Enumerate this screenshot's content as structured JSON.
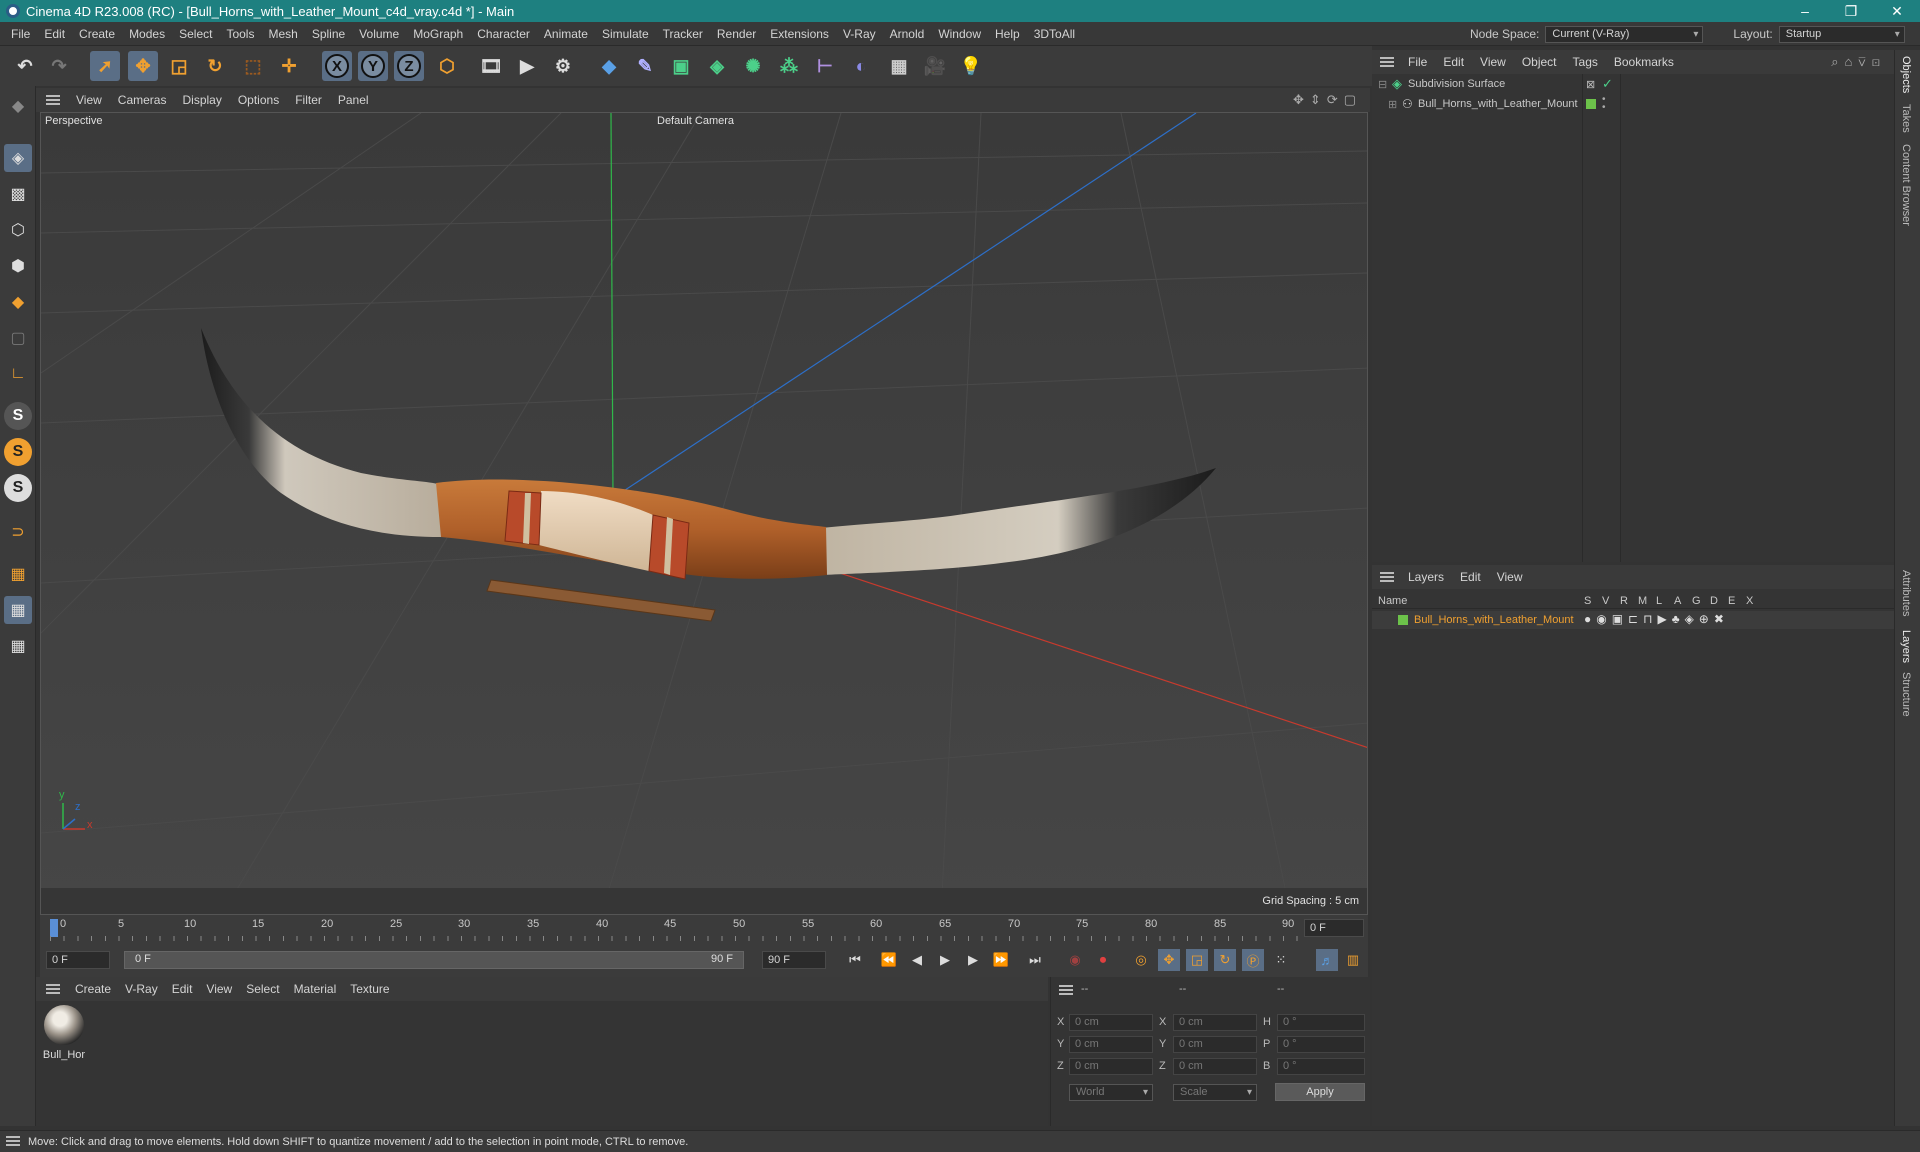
{
  "window": {
    "title": "Cinema 4D R23.008 (RC) - [Bull_Horns_with_Leather_Mount_c4d_vray.c4d *] - Main",
    "controls": [
      "–",
      "❐",
      "✕"
    ]
  },
  "menubar": {
    "items": [
      "File",
      "Edit",
      "Create",
      "Modes",
      "Select",
      "Tools",
      "Mesh",
      "Spline",
      "Volume",
      "MoGraph",
      "Character",
      "Animate",
      "Simulate",
      "Tracker",
      "Render",
      "Extensions",
      "V-Ray",
      "Arnold",
      "Window",
      "Help",
      "3DToAll"
    ],
    "node_space_label": "Node Space:",
    "node_space_value": "Current (V-Ray)",
    "layout_label": "Layout:",
    "layout_value": "Startup"
  },
  "toolbar": {
    "icons": [
      "undo-icon",
      "redo-icon",
      "select-icon",
      "move-icon",
      "scale-icon",
      "rotate-icon",
      "recent-tool-icon",
      "transform-icon",
      "x-axis-icon",
      "y-axis-icon",
      "z-axis-icon",
      "coordinate-system-icon",
      "render-region-icon",
      "render-view-icon",
      "render-settings-icon",
      "cube-icon",
      "pen-icon",
      "subdivision-icon",
      "extrude-icon",
      "cloner-icon",
      "array-icon",
      "symmetry-icon",
      "deformer-icon",
      "floor-icon",
      "camera-icon",
      "light-icon"
    ],
    "axis_labels": [
      "X",
      "Y",
      "Z"
    ]
  },
  "leftbar": {
    "icons": [
      "make-editable-icon",
      "checker-icon",
      "points-mode-icon",
      "edges-mode-icon",
      "polygons-mode-icon",
      "texture-mode-icon",
      "axis-mode-icon",
      "snap-s-icon",
      "snap-s-orange-icon",
      "snap-s-white-icon",
      "magnet-icon",
      "workplane-icon",
      "grid-icon",
      "lock-grid-icon"
    ],
    "s_label": "S"
  },
  "viewport": {
    "menu": [
      "View",
      "Cameras",
      "Display",
      "Options",
      "Filter",
      "Panel"
    ],
    "view_name": "Perspective",
    "camera": "Default Camera",
    "grid_spacing": "Grid Spacing : 5 cm",
    "axis_y": "y",
    "axis_z": "z",
    "axis_x": "x"
  },
  "timeline": {
    "ticks": [
      "0",
      "5",
      "10",
      "15",
      "20",
      "25",
      "30",
      "35",
      "40",
      "45",
      "50",
      "55",
      "60",
      "65",
      "70",
      "75",
      "80",
      "85",
      "90"
    ],
    "current_frame": "0 F",
    "start_frame": "0 F",
    "range_start": "0 F",
    "range_end": "90 F",
    "end_frame": "90 F"
  },
  "material_manager": {
    "menu": [
      "Create",
      "V-Ray",
      "Edit",
      "View",
      "Select",
      "Material",
      "Texture"
    ],
    "materials": [
      {
        "name": "Bull_Hor"
      }
    ]
  },
  "coordinates": {
    "header": [
      "--",
      "--",
      "--"
    ],
    "rows": [
      {
        "axis": "X",
        "pos": "0 cm",
        "axis2": "X",
        "size": "0 cm",
        "rot_axis": "H",
        "rot": "0 °"
      },
      {
        "axis": "Y",
        "pos": "0 cm",
        "axis2": "Y",
        "size": "0 cm",
        "rot_axis": "P",
        "rot": "0 °"
      },
      {
        "axis": "Z",
        "pos": "0 cm",
        "axis2": "Z",
        "size": "0 cm",
        "rot_axis": "B",
        "rot": "0 °"
      }
    ],
    "mode1": "World",
    "mode2": "Scale",
    "apply": "Apply"
  },
  "object_manager": {
    "menu": [
      "File",
      "Edit",
      "View",
      "Object",
      "Tags",
      "Bookmarks"
    ],
    "objects": [
      {
        "name": "Subdivision Surface",
        "color": "#c8c8c8"
      },
      {
        "name": "Bull_Horns_with_Leather_Mount",
        "color": "#c8c8c8"
      }
    ]
  },
  "layer_manager": {
    "menu": [
      "Layers",
      "Edit",
      "View"
    ],
    "columns": [
      "Name",
      "S",
      "V",
      "R",
      "M",
      "L",
      "A",
      "G",
      "D",
      "E",
      "X"
    ],
    "layers": [
      {
        "name": "Bull_Horns_with_Leather_Mount",
        "color": "#6cc24a"
      }
    ]
  },
  "side_tabs": [
    "Objects",
    "Takes",
    "Content Browser",
    "Attributes",
    "Layers",
    "Structure"
  ],
  "status": {
    "text": "Move: Click and drag to move elements. Hold down SHIFT to quantize movement / add to the selection in point mode, CTRL to remove."
  },
  "colors": {
    "title_bar": "#1e8080",
    "selection": "#5a6e86",
    "layer_name": "#f0a030",
    "layer_swatch": "#6cc24a"
  }
}
